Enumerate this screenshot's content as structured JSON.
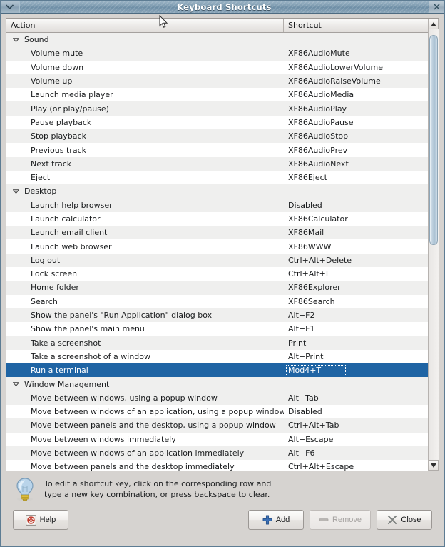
{
  "window": {
    "title": "Keyboard Shortcuts",
    "menu_icon": "chevron-down-icon",
    "close_icon": "close-icon"
  },
  "table": {
    "columns": [
      "Action",
      "Shortcut"
    ],
    "groups": [
      {
        "label": "Sound",
        "expanded": true,
        "rows": [
          {
            "action": "Volume mute",
            "shortcut": "XF86AudioMute"
          },
          {
            "action": "Volume down",
            "shortcut": "XF86AudioLowerVolume"
          },
          {
            "action": "Volume up",
            "shortcut": "XF86AudioRaiseVolume"
          },
          {
            "action": "Launch media player",
            "shortcut": "XF86AudioMedia"
          },
          {
            "action": "Play (or play/pause)",
            "shortcut": "XF86AudioPlay"
          },
          {
            "action": "Pause playback",
            "shortcut": "XF86AudioPause"
          },
          {
            "action": "Stop playback",
            "shortcut": "XF86AudioStop"
          },
          {
            "action": "Previous track",
            "shortcut": "XF86AudioPrev"
          },
          {
            "action": "Next track",
            "shortcut": "XF86AudioNext"
          },
          {
            "action": "Eject",
            "shortcut": "XF86Eject"
          }
        ]
      },
      {
        "label": "Desktop",
        "expanded": true,
        "rows": [
          {
            "action": "Launch help browser",
            "shortcut": "Disabled"
          },
          {
            "action": "Launch calculator",
            "shortcut": "XF86Calculator"
          },
          {
            "action": "Launch email client",
            "shortcut": "XF86Mail"
          },
          {
            "action": "Launch web browser",
            "shortcut": "XF86WWW"
          },
          {
            "action": "Log out",
            "shortcut": "Ctrl+Alt+Delete"
          },
          {
            "action": "Lock screen",
            "shortcut": "Ctrl+Alt+L"
          },
          {
            "action": "Home folder",
            "shortcut": "XF86Explorer"
          },
          {
            "action": "Search",
            "shortcut": "XF86Search"
          },
          {
            "action": "Show the panel's \"Run Application\" dialog box",
            "shortcut": "Alt+F2"
          },
          {
            "action": "Show the panel's main menu",
            "shortcut": "Alt+F1"
          },
          {
            "action": "Take a screenshot",
            "shortcut": "Print"
          },
          {
            "action": "Take a screenshot of a window",
            "shortcut": "Alt+Print"
          },
          {
            "action": "Run a terminal",
            "shortcut": "Mod4+T",
            "selected": true,
            "editing": true
          }
        ]
      },
      {
        "label": "Window Management",
        "expanded": true,
        "rows": [
          {
            "action": "Move between windows, using a popup window",
            "shortcut": "Alt+Tab"
          },
          {
            "action": "Move between windows of an application, using a popup window",
            "shortcut": "Disabled"
          },
          {
            "action": "Move between panels and the desktop, using a popup window",
            "shortcut": "Ctrl+Alt+Tab"
          },
          {
            "action": "Move between windows immediately",
            "shortcut": "Alt+Escape"
          },
          {
            "action": "Move between windows of an application immediately",
            "shortcut": "Alt+F6"
          },
          {
            "action": "Move between panels and the desktop immediately",
            "shortcut": "Ctrl+Alt+Escape"
          }
        ]
      }
    ]
  },
  "hint": {
    "icon": "lightbulb-icon",
    "line1": "To edit a shortcut key, click on the corresponding row  and",
    "line2": "type a new key combination, or press backspace to clear."
  },
  "buttons": {
    "help": {
      "label": "Help",
      "icon": "help-icon",
      "enabled": true
    },
    "add": {
      "label": "Add",
      "icon": "plus-icon",
      "enabled": true
    },
    "remove": {
      "label": "Remove",
      "icon": "minus-icon",
      "enabled": false
    },
    "close": {
      "label": "Close",
      "icon": "close-x-icon",
      "enabled": true
    }
  },
  "scrollbar": {
    "up_icon": "triangle-up-icon",
    "down_icon": "triangle-down-icon"
  },
  "colors": {
    "selection": "#1f64a4",
    "titlebar": "#7c9aaf",
    "row_alt": "#efefee",
    "window_bg": "#d6d3d0"
  }
}
